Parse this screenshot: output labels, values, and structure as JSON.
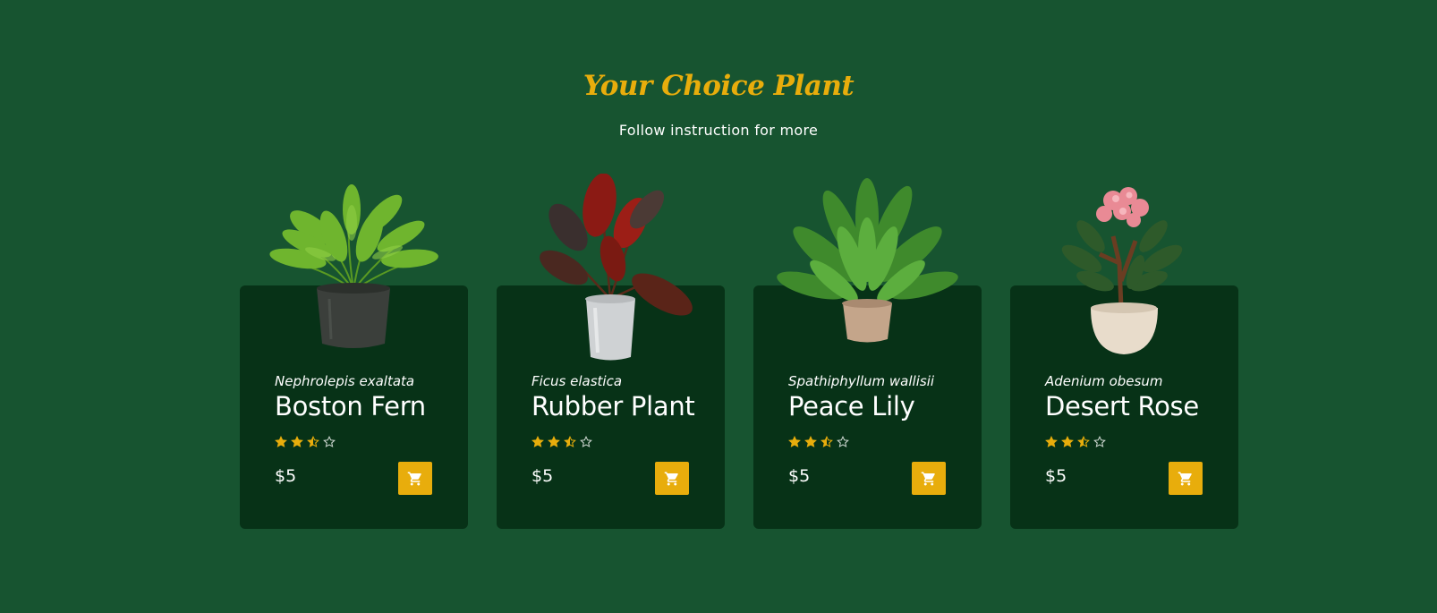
{
  "section": {
    "title": "Your Choice Plant",
    "subtitle": "Follow instruction for more"
  },
  "colors": {
    "background": "#175430",
    "card": "#073217",
    "accent": "#e8ad0c",
    "text": "#ffffff"
  },
  "products": [
    {
      "scientific_name": "Nephrolepis exaltata",
      "name": "Boston Fern",
      "rating": 2.5,
      "rating_max": 4,
      "price": "$5",
      "image_icon": "fern-plant-image",
      "cart_icon": "cart-icon"
    },
    {
      "scientific_name": "Ficus elastica",
      "name": "Rubber Plant",
      "rating": 2.5,
      "rating_max": 4,
      "price": "$5",
      "image_icon": "rubber-plant-image",
      "cart_icon": "cart-icon"
    },
    {
      "scientific_name": "Spathiphyllum wallisii",
      "name": "Peace Lily",
      "rating": 2.5,
      "rating_max": 4,
      "price": "$5",
      "image_icon": "peace-lily-image",
      "cart_icon": "cart-icon"
    },
    {
      "scientific_name": "Adenium obesum",
      "name": "Desert Rose",
      "rating": 2.5,
      "rating_max": 4,
      "price": "$5",
      "image_icon": "desert-rose-image",
      "cart_icon": "cart-icon"
    }
  ]
}
